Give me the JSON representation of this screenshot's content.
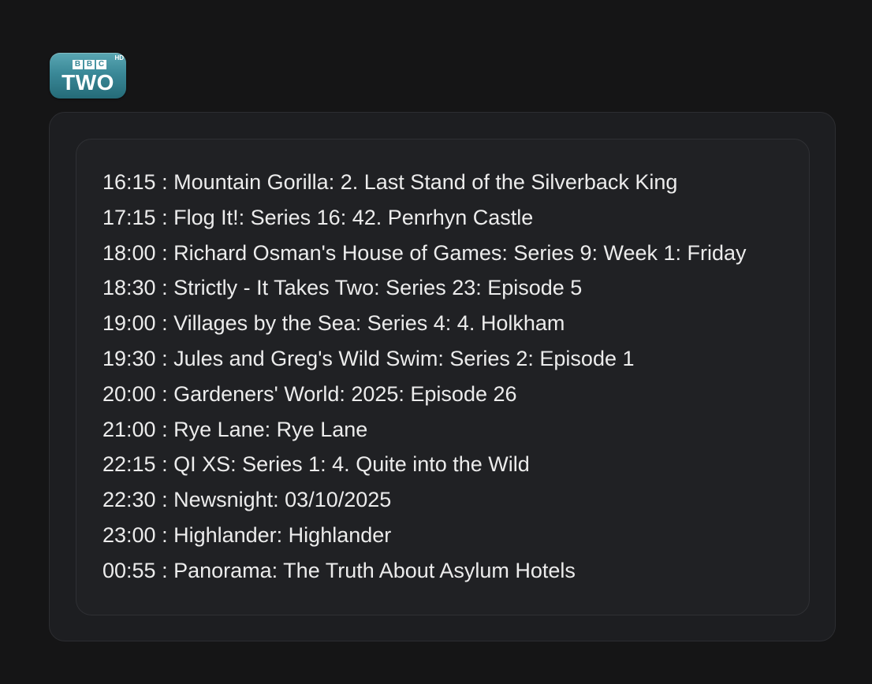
{
  "channel": {
    "logo": {
      "badge_letters": [
        "B",
        "B",
        "C"
      ],
      "name": "TWO",
      "hd_label": "HD"
    }
  },
  "schedule": [
    {
      "time": "16:15",
      "title": "Mountain Gorilla: 2. Last Stand of the Silverback King"
    },
    {
      "time": "17:15",
      "title": "Flog It!: Series 16: 42. Penrhyn Castle"
    },
    {
      "time": "18:00",
      "title": "Richard Osman's House of Games: Series 9: Week 1: Friday"
    },
    {
      "time": "18:30",
      "title": "Strictly - It Takes Two: Series 23: Episode 5"
    },
    {
      "time": "19:00",
      "title": "Villages by the Sea: Series 4: 4. Holkham"
    },
    {
      "time": "19:30",
      "title": "Jules and Greg's Wild Swim: Series 2: Episode 1"
    },
    {
      "time": "20:00",
      "title": "Gardeners' World: 2025: Episode 26"
    },
    {
      "time": "21:00",
      "title": "Rye Lane: Rye Lane"
    },
    {
      "time": "22:15",
      "title": "QI XS: Series 1: 4. Quite into the Wild"
    },
    {
      "time": "22:30",
      "title": "Newsnight: 03/10/2025"
    },
    {
      "time": "23:00",
      "title": "Highlander: Highlander"
    },
    {
      "time": "00:55",
      "title": "Panorama: The Truth About Asylum Hotels"
    }
  ],
  "separator": " : "
}
